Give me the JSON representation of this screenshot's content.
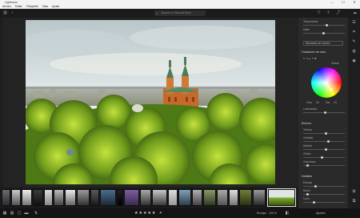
{
  "window": {
    "title": "Lightroom",
    "min": "—",
    "max": "☐",
    "close": "✕"
  },
  "menu": [
    "Archivo",
    "Editar",
    "Fotografía",
    "Vista",
    "Ayuda"
  ],
  "search": {
    "placeholder": "Buscar en Todas las fotos"
  },
  "panel": {
    "slider_top_label": "Temperatura",
    "slider_top2_label": "Matiz",
    "dropdown1": "Mezclador de colores",
    "section_color": "Gradación de color",
    "color_modes_label": "Global",
    "wheel_h_label": "Tono",
    "wheel_s_label": "Sat",
    "wheel_h_value": "26",
    "wheel_s_value": "23",
    "luminance_label": "Luminancia",
    "section_effects": "Efectos",
    "effects_items": [
      "Textura",
      "Claridad",
      "Neblina",
      "Viñeta",
      "Granulado"
    ],
    "section_detail": "Detalles",
    "detail_items": [
      "Enfocar",
      "Ruido",
      "Color"
    ]
  },
  "bottom": {
    "stars": "★★★★★",
    "flag_label": "⚑",
    "compare_label": "Encajar",
    "zoom_label": "100 %",
    "presets_label": "Ajustes"
  },
  "colors": {
    "accent": "#d9d9d9",
    "panel_bg": "#2a2a2a",
    "app_bg": "#232323"
  }
}
